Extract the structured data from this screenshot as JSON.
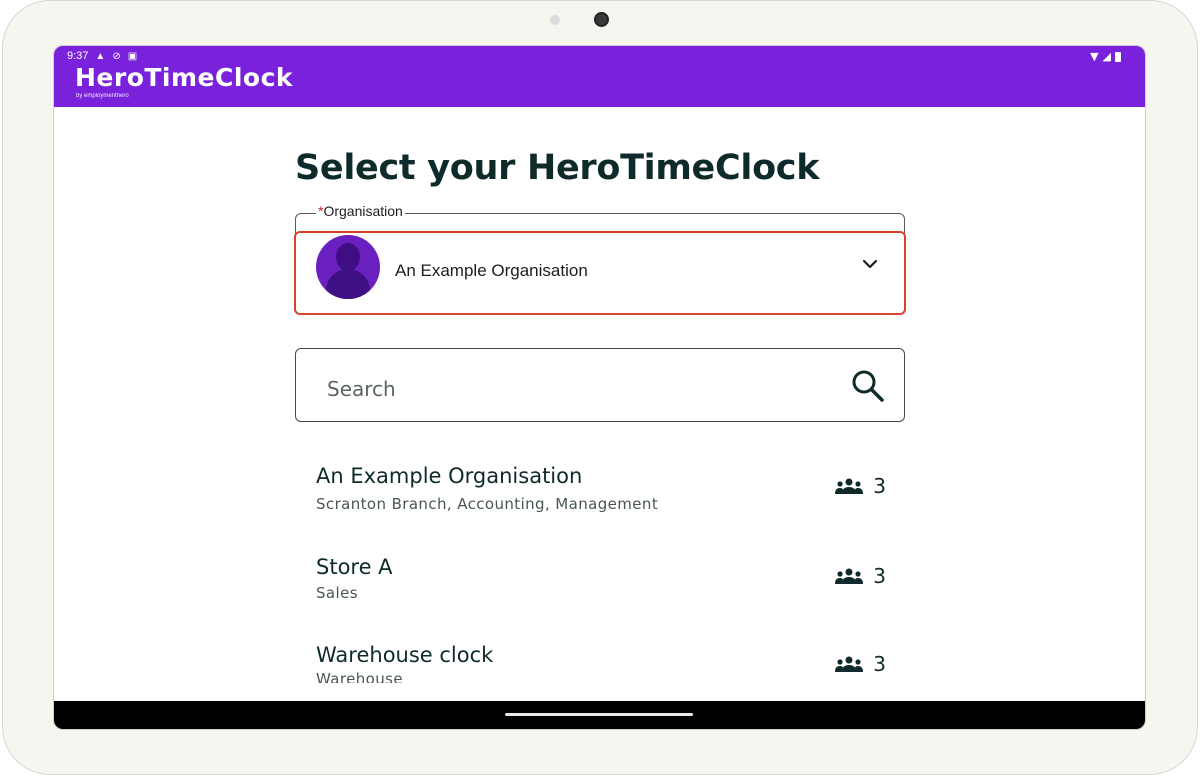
{
  "status_bar": {
    "time": "9:37"
  },
  "app_bar": {
    "brand": "HeroTimeClock",
    "brand_sub": "by employmenthero",
    "color": "#7a22db"
  },
  "page": {
    "title": "Select your HeroTimeClock"
  },
  "organisation_field": {
    "required_mark": "*",
    "label": "Organisation",
    "selected_value": "An Example Organisation",
    "highlight_color": "#d7442e"
  },
  "search": {
    "placeholder": "Search"
  },
  "clocks": [
    {
      "name": "An Example Organisation",
      "sub": "Scranton Branch, Accounting, Management",
      "count": "3"
    },
    {
      "name": "Store A",
      "sub": "Sales",
      "count": "3"
    },
    {
      "name": "Warehouse clock",
      "sub": "Warehouse",
      "count": "3"
    }
  ]
}
